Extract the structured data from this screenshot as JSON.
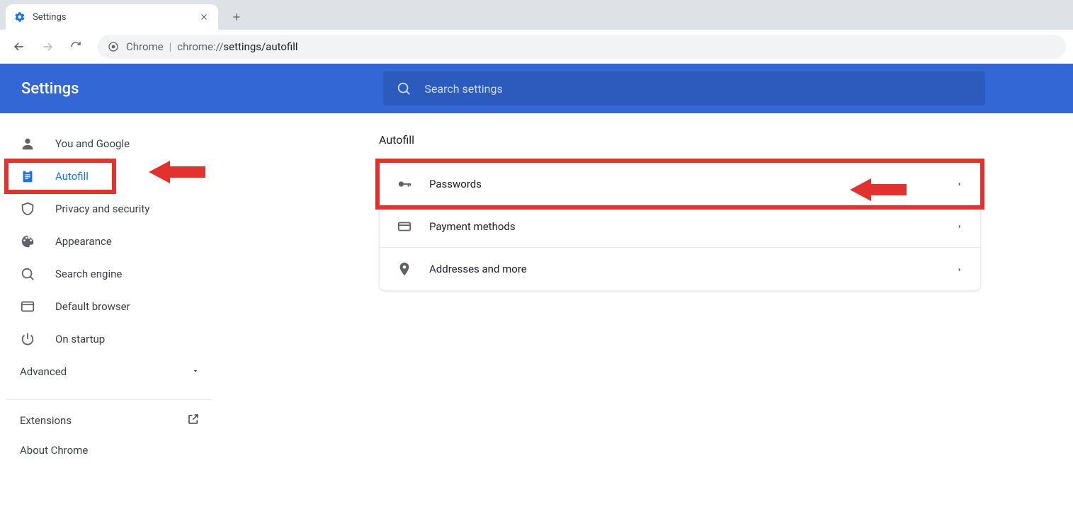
{
  "browser": {
    "tab_title": "Settings",
    "url_prefix": "Chrome",
    "url_dim": "chrome://",
    "url_mid": "settings/autofill"
  },
  "header": {
    "title": "Settings",
    "search_placeholder": "Search settings"
  },
  "sidebar": {
    "items": [
      {
        "label": "You and Google"
      },
      {
        "label": "Autofill"
      },
      {
        "label": "Privacy and security"
      },
      {
        "label": "Appearance"
      },
      {
        "label": "Search engine"
      },
      {
        "label": "Default browser"
      },
      {
        "label": "On startup"
      }
    ],
    "advanced": "Advanced",
    "extensions": "Extensions",
    "about": "About Chrome"
  },
  "main": {
    "section_title": "Autofill",
    "rows": [
      {
        "label": "Passwords"
      },
      {
        "label": "Payment methods"
      },
      {
        "label": "Addresses and more"
      }
    ]
  }
}
